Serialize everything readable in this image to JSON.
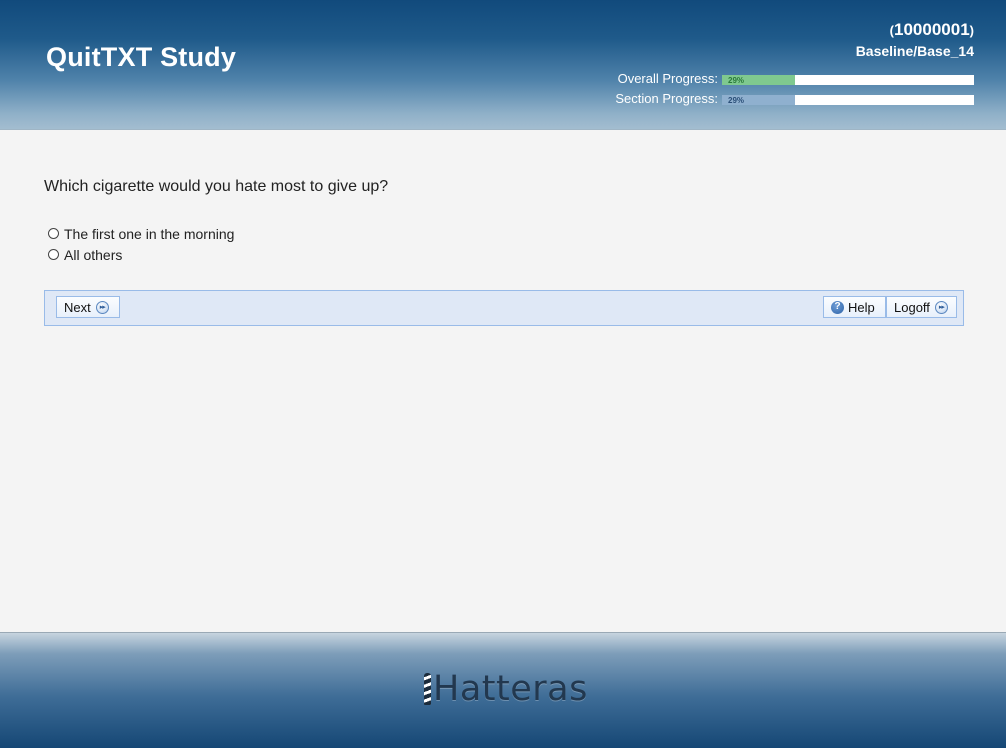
{
  "header": {
    "study_title": "QuitTXT Study",
    "participant_id": "10000001",
    "paren_open": "(",
    "paren_close": ")",
    "session": "Baseline/Base_14",
    "overall_progress": {
      "label": "Overall Progress:",
      "percent_text": "29%",
      "value": 0.29,
      "color": "#7fc98f"
    },
    "section_progress": {
      "label": "Section Progress:",
      "percent_text": "29%",
      "value": 0.29,
      "color": "#8fb0cf"
    }
  },
  "question": {
    "text": "Which cigarette would you hate most to give up?",
    "options": [
      {
        "label": "The first one in the morning",
        "selected": false
      },
      {
        "label": "All others",
        "selected": false
      }
    ]
  },
  "navbar": {
    "next_label": "Next",
    "help_label": "Help",
    "logoff_label": "Logoff",
    "next_icon": "forward-icon",
    "help_icon": "help-icon",
    "logoff_icon": "forward-icon"
  },
  "footer": {
    "brand": "Hatteras",
    "brand_icon": "lighthouse-icon"
  }
}
